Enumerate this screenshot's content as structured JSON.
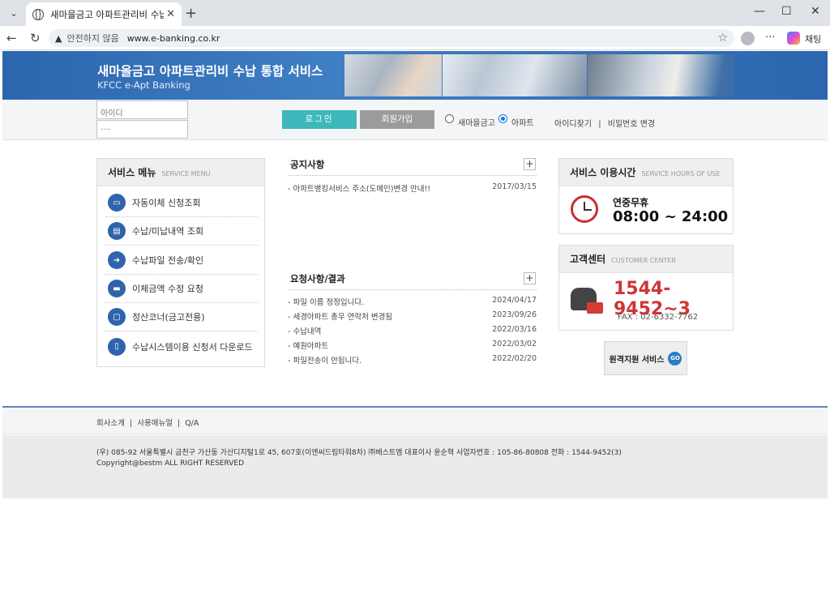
{
  "browser": {
    "tab_title": "새마을금고 아파트관리비 수납 통합",
    "security_label": "안전하지 않음",
    "url": "www.e-banking.co.kr",
    "chat_label": "채팅"
  },
  "banner": {
    "title": "새마을금고 아파트관리비 수납 통합 서비스",
    "subtitle": "KFCC e-Apt Banking"
  },
  "login": {
    "id_placeholder": "아이디",
    "pw_value": "····",
    "login_label": "로그인",
    "join_label": "회원가입",
    "radio_options": [
      "새마을금고",
      "아파트"
    ],
    "radio_selected": "아파트",
    "find_id": "아이디찾기",
    "change_pw": "비밀번호 변경",
    "link_separator": "|"
  },
  "service_menu": {
    "title": "서비스 메뉴",
    "title_en": "SERVICE MENU",
    "items": [
      {
        "label": "자동이체 신청조회",
        "icon": "monitor-icon"
      },
      {
        "label": "수납/미납내역 조회",
        "icon": "receipt-icon"
      },
      {
        "label": "수납파일 전송/확인",
        "icon": "file-send-icon"
      },
      {
        "label": "이체금액 수정 요청",
        "icon": "laptop-icon"
      },
      {
        "label": "정산코너(금고전용)",
        "icon": "folder-icon"
      },
      {
        "label": "수납시스템이용 신청서 다운로드",
        "icon": "document-icon"
      }
    ]
  },
  "notices": {
    "title": "공지사항",
    "more": "+",
    "items": [
      {
        "title": "- 아파트뱅킹서비스 주소(도메인)변경 안내!!",
        "date": "2017/03/15"
      }
    ]
  },
  "requests": {
    "title": "요청사항/결과",
    "more": "+",
    "items": [
      {
        "title": "- 파일 이름 정정입니다.",
        "date": "2024/04/17"
      },
      {
        "title": "- 세경아파트 총무 연락처 변경됨",
        "date": "2023/09/26"
      },
      {
        "title": "- 수납내역",
        "date": "2022/03/16"
      },
      {
        "title": "- 예원아파트",
        "date": "2022/03/02"
      },
      {
        "title": "- 파일전송이 안됩니다.",
        "date": "2022/02/20"
      }
    ]
  },
  "service_hours": {
    "title": "서비스 이용시간",
    "title_en": "SERVICE HOURS OF USE",
    "line1": "연중무휴",
    "line2": "08:00 ~ 24:00"
  },
  "customer_center": {
    "title": "고객센터",
    "title_en": "CUSTOMER CENTER",
    "phone": "1544-9452~3",
    "fax": "FAX : 02-6332-7762"
  },
  "remote": {
    "label": "원격지원 서비스",
    "go": "GO"
  },
  "footer": {
    "links": [
      "회사소개",
      "사용매뉴얼",
      "Q/A"
    ],
    "link_separator": "|",
    "address": "(우) 085-92 서울특별시 금천구 가산동 가산디지털1로 45, 607호(이앤씨드림타워8차) ㈜베스트엠 대표이사 윤순혁 사업자번호 : 105-86-80808 전화 : 1544-9452(3)",
    "copyright": "Copyright@bestm ALL RIGHT RESERVED"
  },
  "colors": {
    "banner": "#2c66ae",
    "login_button": "#3fb8bc",
    "join_button": "#9b9b9b",
    "phone_red": "#d03535"
  }
}
